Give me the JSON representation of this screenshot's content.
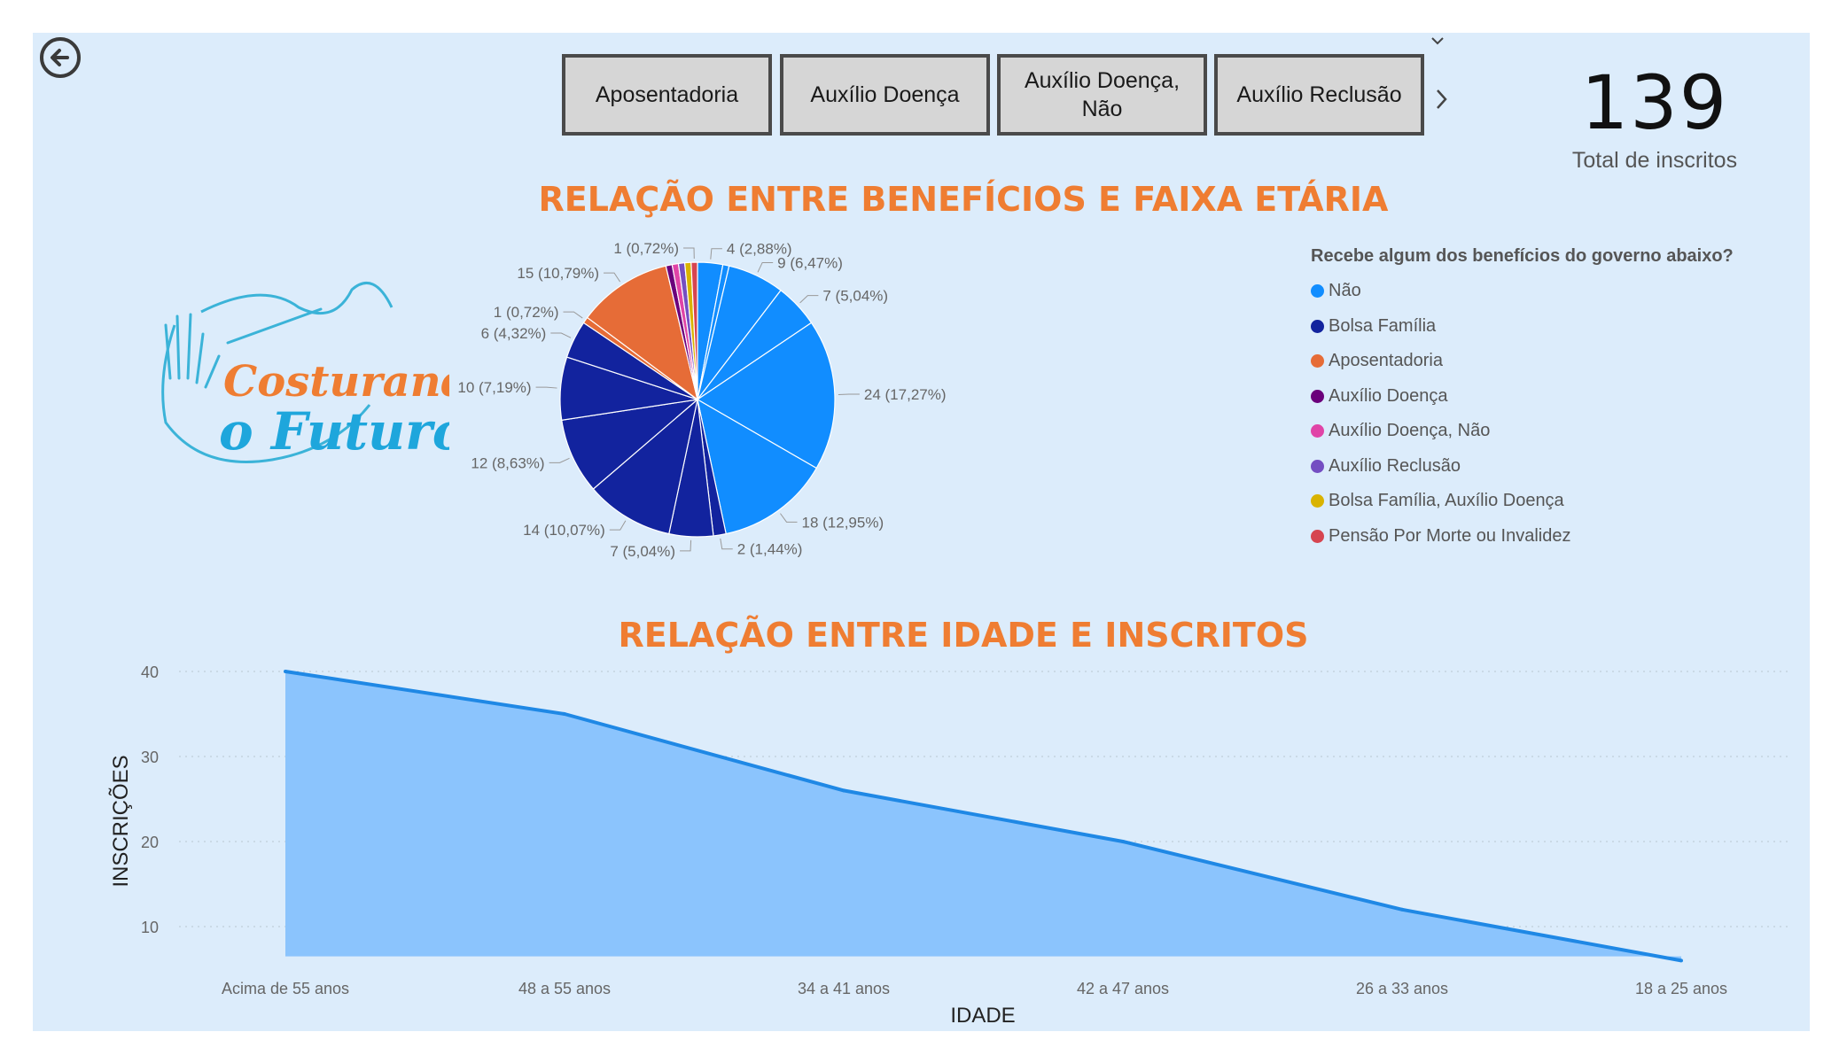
{
  "navigation": {
    "back_icon": "arrow-left-circle-icon"
  },
  "slicer": {
    "buttons": [
      "Aposentadoria",
      "Auxílio Doença",
      "Auxílio Doença, Não",
      "Auxílio Reclusão"
    ],
    "next_icon": "chevron-right-icon",
    "collapse_icon": "chevron-down-icon"
  },
  "kpi": {
    "value": "139",
    "label": "Total de inscritos"
  },
  "logo": {
    "text_line1": "Costurando",
    "text_line2": "o Futuro",
    "icon": "hands-thread-icon"
  },
  "colors": {
    "background": "#dcecfb",
    "title": "#ef7d32",
    "area_fill": "#8bc4fd",
    "area_line": "#1f88e5"
  },
  "chart_data": [
    {
      "type": "pie",
      "title": "RELAÇÃO ENTRE BENEFÍCIOS E FAIXA ETÁRIA",
      "legend_title": "Recebe algum dos benefícios do governo abaixo?",
      "legend_position": "right",
      "legend": [
        {
          "name": "Não",
          "color": "#118dff"
        },
        {
          "name": "Bolsa Família",
          "color": "#12239e"
        },
        {
          "name": "Aposentadoria",
          "color": "#e66c37"
        },
        {
          "name": "Auxílio Doença",
          "color": "#6b007b"
        },
        {
          "name": "Auxílio Doença, Não",
          "color": "#e044a7"
        },
        {
          "name": "Auxílio Reclusão",
          "color": "#744ec2"
        },
        {
          "name": "Bolsa Família, Auxílio Doença",
          "color": "#d9b300"
        },
        {
          "name": "Pensão Por Morte ou Invalidez",
          "color": "#d64550"
        }
      ],
      "slices": [
        {
          "value": 4,
          "label": "4 (2,88%)",
          "color": "#118dff"
        },
        {
          "value": 1,
          "label": "",
          "color": "#118dff"
        },
        {
          "value": 9,
          "label": "9 (6,47%)",
          "color": "#118dff"
        },
        {
          "value": 7,
          "label": "7 (5,04%)",
          "color": "#118dff"
        },
        {
          "value": 24,
          "label": "24 (17,27%)",
          "color": "#118dff"
        },
        {
          "value": 18,
          "label": "18 (12,95%)",
          "color": "#118dff"
        },
        {
          "value": 2,
          "label": "2 (1,44%)",
          "color": "#12239e"
        },
        {
          "value": 7,
          "label": "7 (5,04%)",
          "color": "#12239e"
        },
        {
          "value": 14,
          "label": "14 (10,07%)",
          "color": "#12239e"
        },
        {
          "value": 12,
          "label": "12 (8,63%)",
          "color": "#12239e"
        },
        {
          "value": 10,
          "label": "10 (7,19%)",
          "color": "#12239e"
        },
        {
          "value": 6,
          "label": "6 (4,32%)",
          "color": "#12239e"
        },
        {
          "value": 1,
          "label": "1 (0,72%)",
          "color": "#e66c37"
        },
        {
          "value": 15,
          "label": "15 (10,79%)",
          "color": "#e66c37"
        },
        {
          "value": 1,
          "label": "",
          "color": "#6b007b"
        },
        {
          "value": 1,
          "label": "",
          "color": "#e044a7"
        },
        {
          "value": 1,
          "label": "",
          "color": "#744ec2"
        },
        {
          "value": 1,
          "label": "",
          "color": "#d9b300"
        },
        {
          "value": 1,
          "label": "1 (0,72%)",
          "color": "#d64550"
        }
      ]
    },
    {
      "type": "area",
      "title": "RELAÇÃO ENTRE IDADE E INSCRITOS",
      "xlabel": "IDADE",
      "ylabel": "INSCRIÇÕES",
      "categories": [
        "Acima de 55 anos",
        "48 a 55 anos",
        "34 a 41 anos",
        "42 a 47 anos",
        "26 a 33 anos",
        "18 a 25 anos"
      ],
      "values": [
        40,
        35,
        26,
        20,
        12,
        6
      ],
      "ylim": [
        6.5,
        42
      ],
      "yticks": [
        10,
        20,
        30,
        40
      ],
      "grid": true
    }
  ]
}
